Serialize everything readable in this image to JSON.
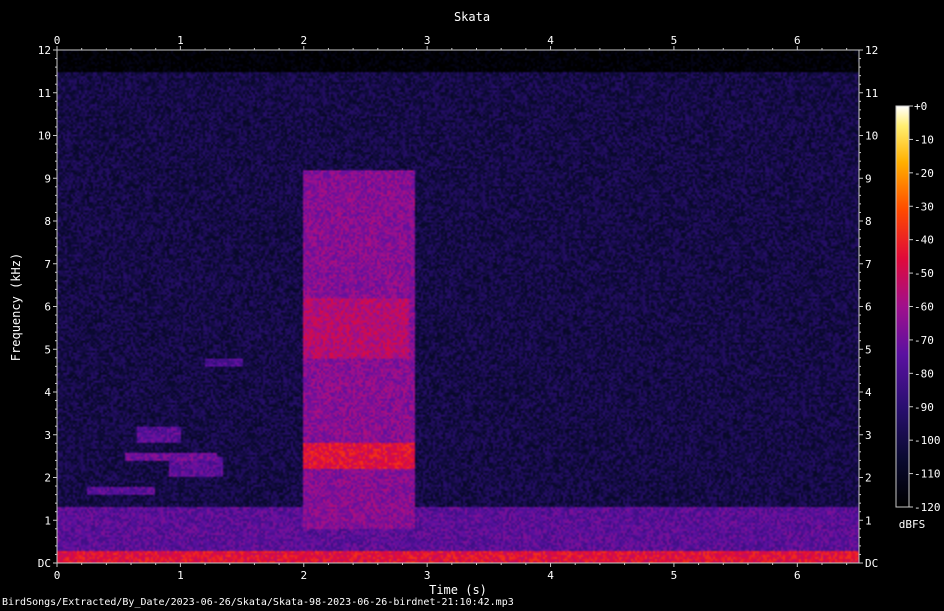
{
  "chart_data": {
    "type": "heatmap",
    "title": "Skata",
    "xlabel": "Time (s)",
    "ylabel": "Frequency (kHz)",
    "xlim": [
      0,
      6.5
    ],
    "ylim": [
      0,
      12
    ],
    "x_ticks": [
      "0",
      "1",
      "2",
      "3",
      "4",
      "5",
      "6"
    ],
    "y_ticks": [
      "DC",
      "1",
      "2",
      "3",
      "4",
      "5",
      "6",
      "7",
      "8",
      "9",
      "10",
      "11",
      "12"
    ],
    "colorbar": {
      "label": "dBFS",
      "range": [
        -120,
        0
      ],
      "ticks": [
        "+0",
        "-10",
        "-20",
        "-30",
        "-40",
        "-50",
        "-60",
        "-70",
        "-80",
        "-90",
        "-100",
        "-110",
        "-120"
      ]
    },
    "background_level_db": -100,
    "features": [
      {
        "t0": 2.0,
        "t1": 2.9,
        "f0": 0.8,
        "f1": 9.2,
        "level_db": -65
      },
      {
        "t0": 2.0,
        "t1": 2.9,
        "f0": 2.2,
        "f1": 2.8,
        "level_db": -45
      },
      {
        "t0": 2.0,
        "t1": 2.85,
        "f0": 4.8,
        "f1": 6.2,
        "level_db": -55
      },
      {
        "t0": 0.25,
        "t1": 0.8,
        "f0": 1.6,
        "f1": 1.8,
        "level_db": -75
      },
      {
        "t0": 0.55,
        "t1": 1.3,
        "f0": 2.4,
        "f1": 2.6,
        "level_db": -70
      },
      {
        "t0": 0.65,
        "t1": 1.0,
        "f0": 2.8,
        "f1": 3.2,
        "level_db": -75
      },
      {
        "t0": 0.9,
        "t1": 1.35,
        "f0": 2.0,
        "f1": 2.5,
        "level_db": -75
      },
      {
        "t0": 1.2,
        "t1": 1.5,
        "f0": 4.6,
        "f1": 4.8,
        "level_db": -80
      },
      {
        "t0": 0.0,
        "t1": 6.5,
        "f0": 0.0,
        "f1": 0.3,
        "level_db": -45
      },
      {
        "t0": 0.0,
        "t1": 6.5,
        "f0": 0.3,
        "f1": 1.3,
        "level_db": -75
      }
    ]
  },
  "footer_path": "BirdSongs/Extracted/By_Date/2023-06-26/Skata/Skata-98-2023-06-26-birdnet-21:10:42.mp3"
}
